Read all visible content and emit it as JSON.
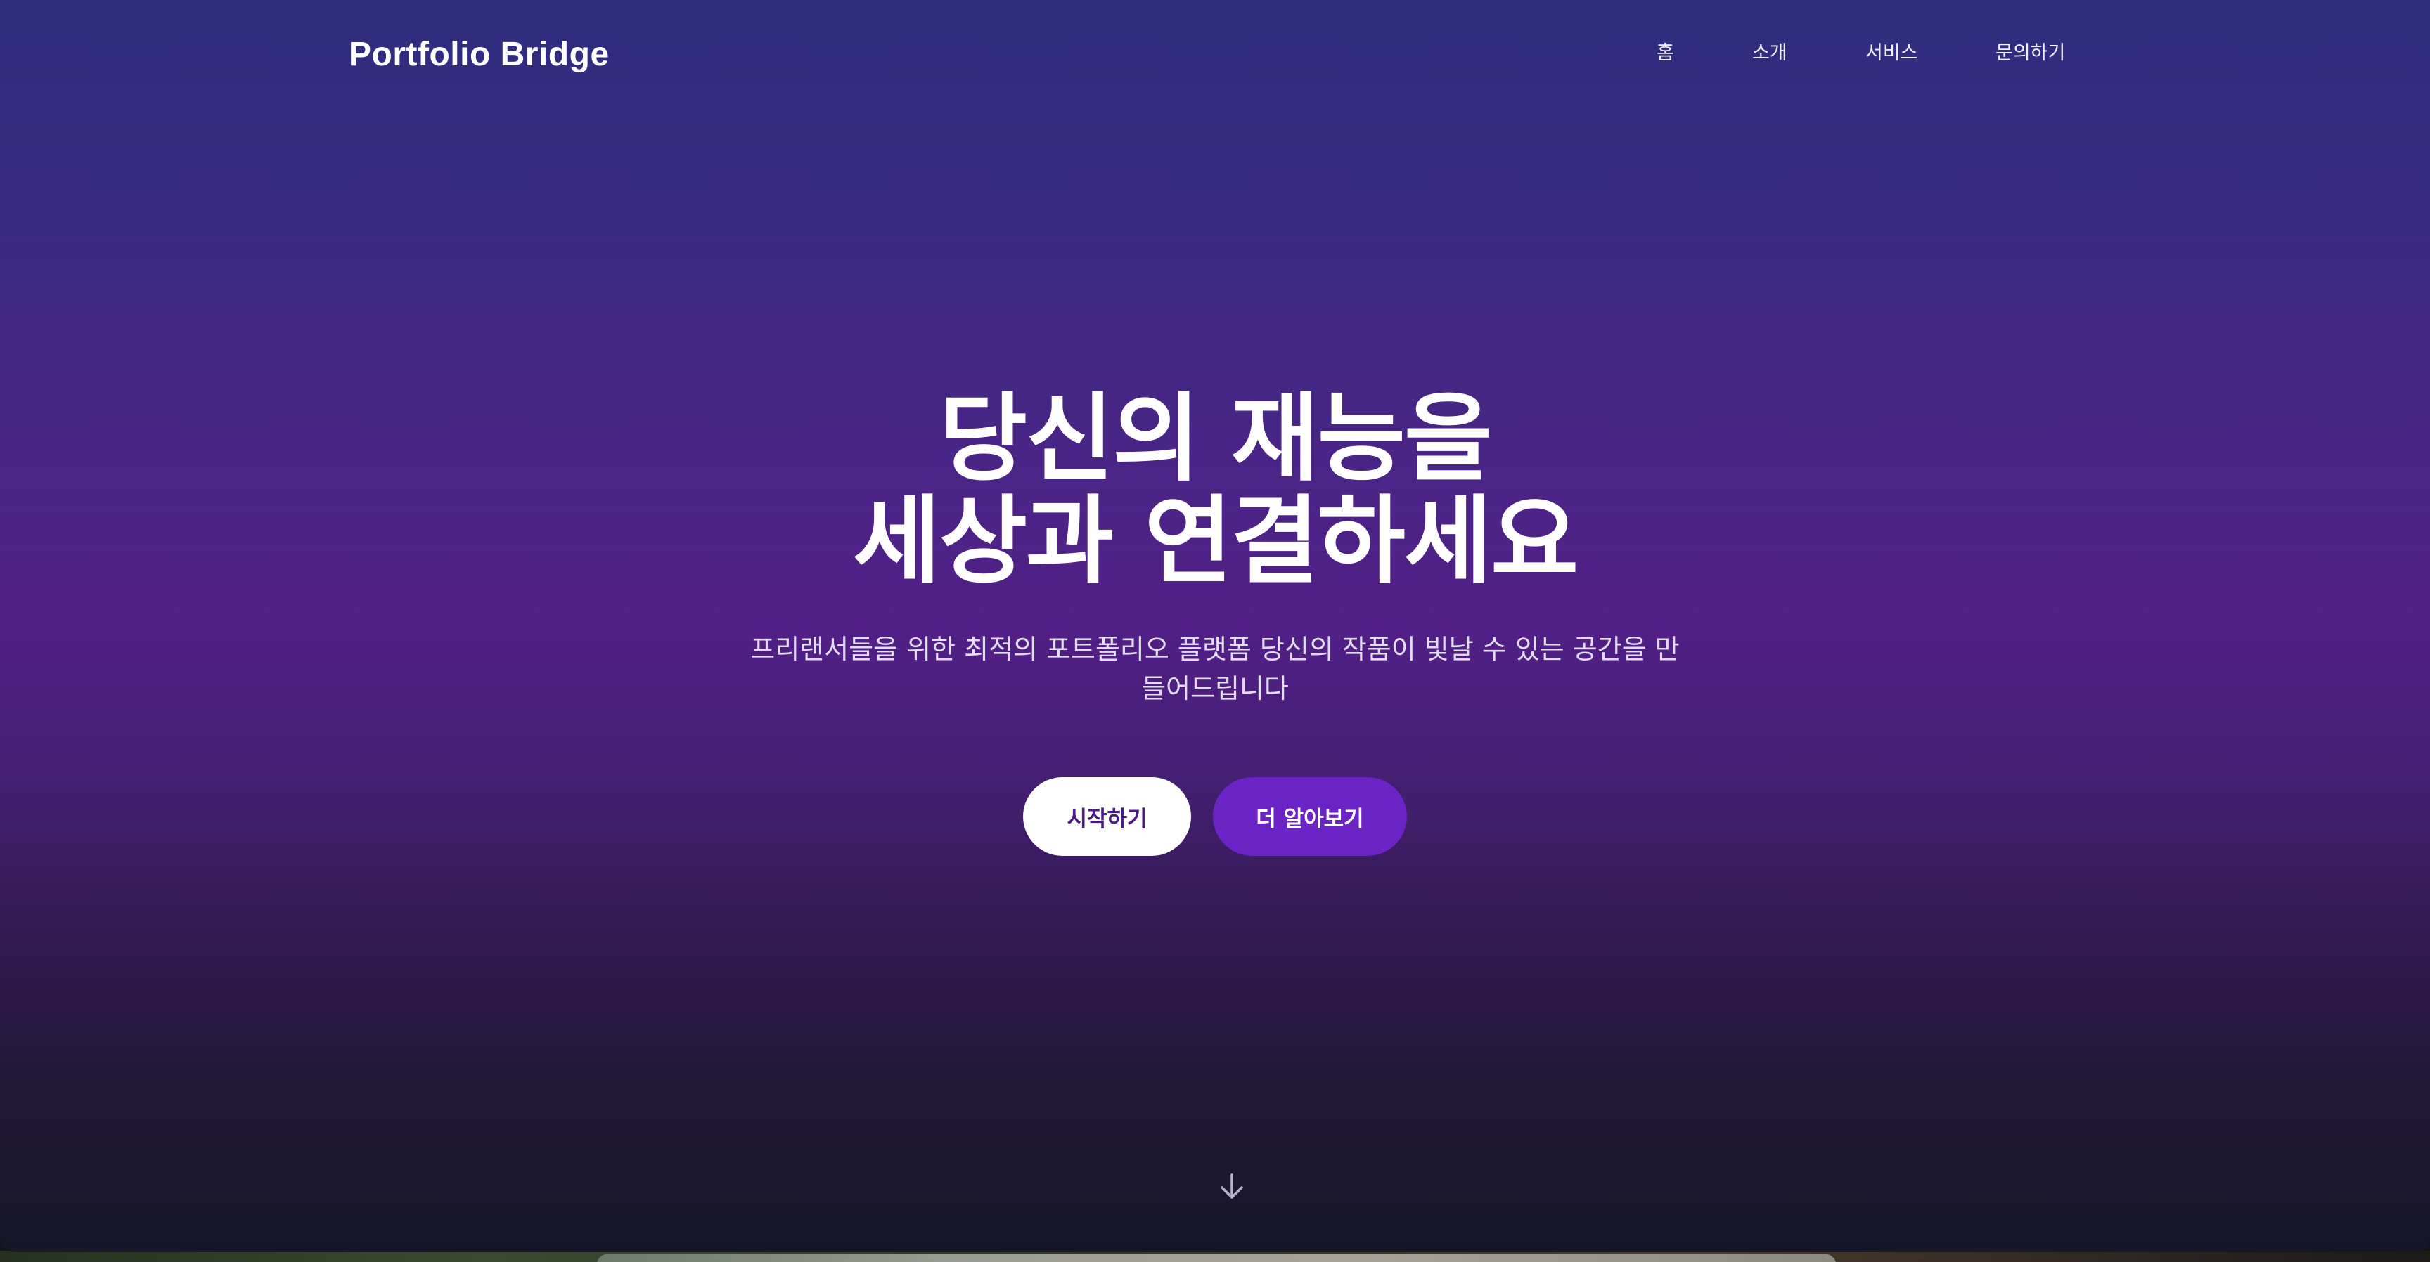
{
  "brand": {
    "logo": "Portfolio Bridge"
  },
  "nav": {
    "items": [
      {
        "label": "홈"
      },
      {
        "label": "소개"
      },
      {
        "label": "서비스"
      },
      {
        "label": "문의하기"
      }
    ]
  },
  "hero": {
    "headline_line1": "당신의 재능을",
    "headline_line2": "세상과 연결하세요",
    "subtitle": "프리랜서들을 위한 최적의 포트폴리오 플랫폼 당신의 작품이 빛날 수 있는 공간을 만들어드립니다",
    "primary_button": "시작하기",
    "secondary_button": "더 알아보기",
    "scroll_icon": "arrow-down-icon"
  },
  "colors": {
    "gradient_top": "#2e2d7e",
    "gradient_mid": "#521f88",
    "gradient_bottom": "#161628",
    "primary_button_bg": "#ffffff",
    "primary_button_text": "#4a1b86",
    "secondary_button_bg": "#6a23c4",
    "secondary_button_text": "#ffffff"
  }
}
